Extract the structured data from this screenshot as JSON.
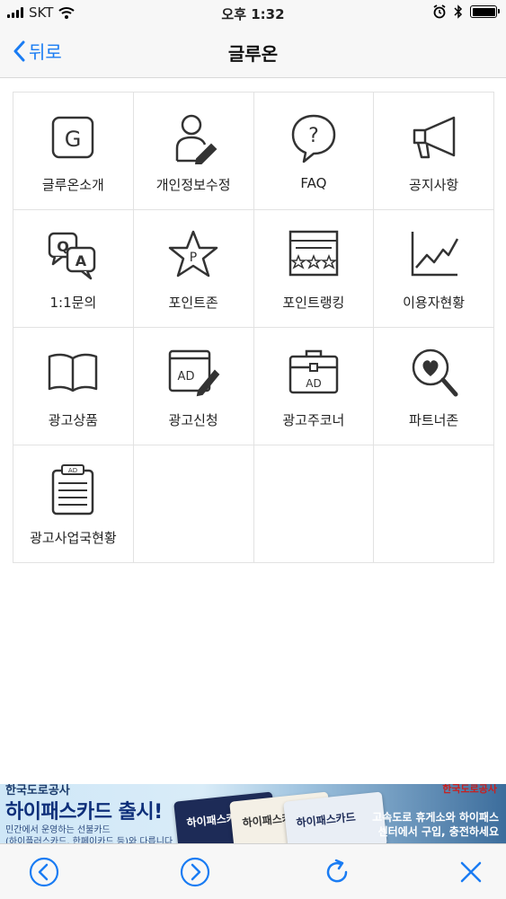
{
  "status_bar": {
    "carrier": "SKT",
    "time": "오후 1:32",
    "icons": [
      "signal-icon",
      "wifi-icon",
      "alarm-icon",
      "bluetooth-icon",
      "battery-icon"
    ]
  },
  "nav": {
    "back_label": "뒤로",
    "title": "글루온"
  },
  "menu": {
    "items": [
      {
        "label": "글루온소개",
        "icon": "g-logo-icon"
      },
      {
        "label": "개인정보수정",
        "icon": "user-edit-icon"
      },
      {
        "label": "FAQ",
        "icon": "question-bubble-icon"
      },
      {
        "label": "공지사항",
        "icon": "megaphone-icon"
      },
      {
        "label": "1:1문의",
        "icon": "qa-bubbles-icon"
      },
      {
        "label": "포인트존",
        "icon": "point-star-icon"
      },
      {
        "label": "포인트랭킹",
        "icon": "ranking-board-icon"
      },
      {
        "label": "이용자현황",
        "icon": "line-chart-icon"
      },
      {
        "label": "광고상품",
        "icon": "open-book-icon"
      },
      {
        "label": "광고신청",
        "icon": "ad-edit-icon"
      },
      {
        "label": "광고주코너",
        "icon": "ad-briefcase-icon"
      },
      {
        "label": "파트너존",
        "icon": "heart-search-icon"
      },
      {
        "label": "광고사업국현황",
        "icon": "ad-clipboard-icon"
      }
    ]
  },
  "ad": {
    "small_top": "한국도로공사",
    "headline": "하이패스카드 출시!",
    "sub1": "민간에서 운영하는 선불카드",
    "sub2": "(하이플러스카드, 한페이카드 등)와 다릅니다",
    "card_text": "하이패스카드",
    "logo": "한국도로공사",
    "right1": "고속도로 휴게소와 하이패스",
    "right2": "센터에서 구입, 충전하세요",
    "colors": {
      "headline": "#0e2f7a",
      "logo": "#c82020"
    }
  },
  "toolbar": {
    "buttons": [
      "back-arrow-icon",
      "forward-arrow-icon",
      "refresh-icon",
      "close-icon"
    ],
    "accent": "#1a7cf3"
  }
}
